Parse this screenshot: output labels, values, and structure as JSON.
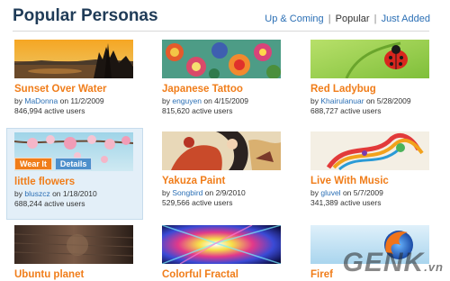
{
  "header": {
    "title": "Popular Personas",
    "nav": {
      "up_coming": "Up & Coming",
      "sep1": "|",
      "popular": "Popular",
      "sep2": "|",
      "just_added": "Just Added"
    }
  },
  "personas": [
    {
      "title": "Sunset Over Water",
      "by": "by",
      "author": "MaDonna",
      "on": "on 11/2/2009",
      "users": "846,994 active users"
    },
    {
      "title": "Japanese Tattoo",
      "by": "by",
      "author": "enguyen",
      "on": "on 4/15/2009",
      "users": "815,620 active users"
    },
    {
      "title": "Red Ladybug",
      "by": "by",
      "author": "Khairulanuar",
      "on": "on 5/28/2009",
      "users": "688,727 active users"
    },
    {
      "title": "little flowers",
      "by": "by",
      "author": "bluszcz",
      "on": "on 1/18/2010",
      "users": "688,244 active users",
      "wear_label": "Wear It",
      "details_label": "Details"
    },
    {
      "title": "Yakuza Paint",
      "by": "by",
      "author": "Songbird",
      "on": "on 2/9/2010",
      "users": "529,566 active users"
    },
    {
      "title": "Live With Music",
      "by": "by",
      "author": "gluvel",
      "on": "on 5/7/2009",
      "users": "341,389 active users"
    },
    {
      "title": "Ubuntu planet"
    },
    {
      "title": "Colorful Fractal"
    },
    {
      "title": "Firef"
    }
  ],
  "watermark": {
    "main": "GENK",
    "suffix": ".vn"
  }
}
